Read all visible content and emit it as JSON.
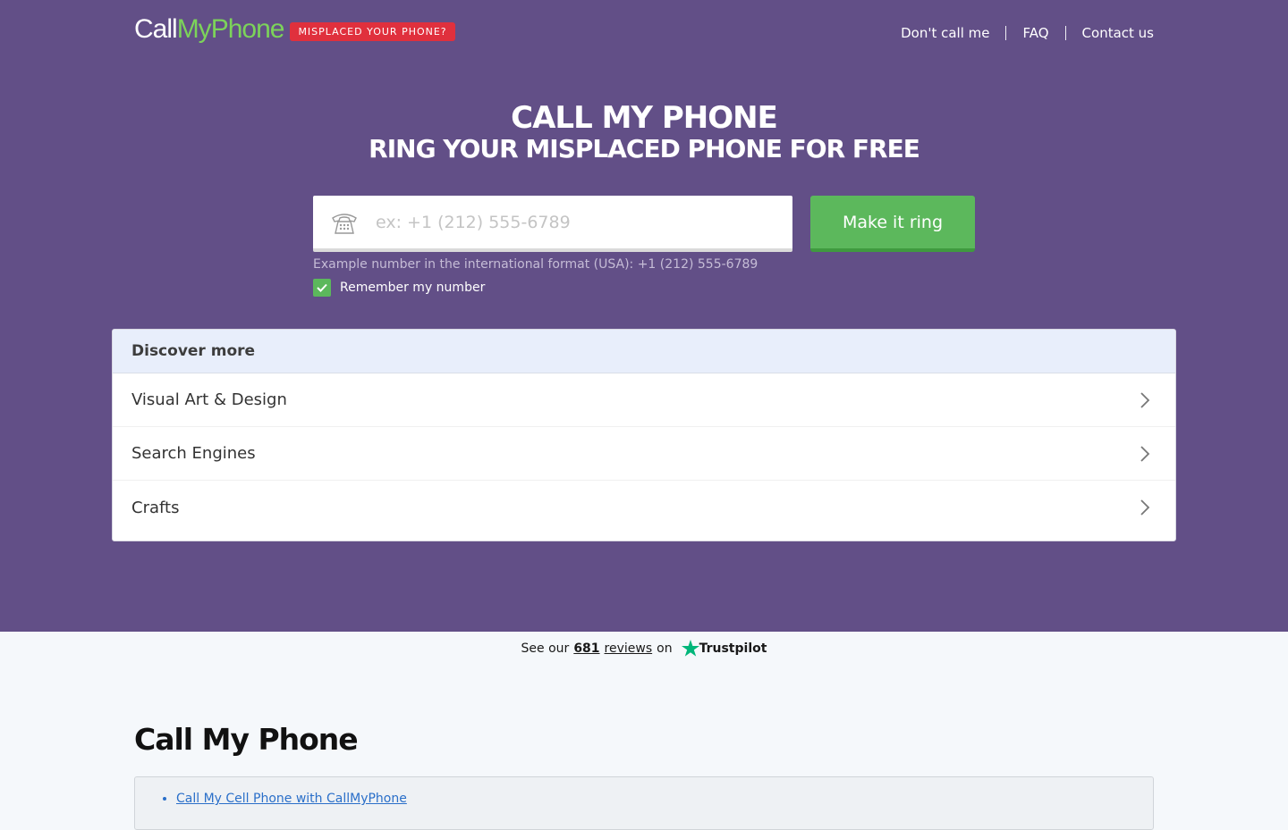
{
  "header": {
    "logo_call": "Call",
    "logo_my": "My",
    "logo_phone": "Phone",
    "badge": "MISPLACED YOUR PHONE?",
    "nav": [
      "Don't call me",
      "FAQ",
      "Contact us"
    ]
  },
  "hero": {
    "title": "CALL MY PHONE",
    "subtitle": "RING YOUR MISPLACED PHONE FOR FREE",
    "phone_placeholder": "ex: +1 (212) 555-6789",
    "button": "Make it ring",
    "hint": "Example number in the international format (USA): +1 (212) 555-6789",
    "remember_label": "Remember my number",
    "remember_checked": true
  },
  "discover": {
    "title": "Discover more",
    "items": [
      "Visual Art & Design",
      "Search Engines",
      "Crafts"
    ]
  },
  "trustpilot": {
    "prefix": "See our",
    "count": "681",
    "reviews_word": "reviews",
    "on": "on",
    "brand": "Trustpilot",
    "star_color": "#00b67a"
  },
  "content": {
    "heading": "Call My Phone",
    "toc": [
      "Call My Cell Phone with CallMyPhone"
    ]
  },
  "colors": {
    "hero_bg": "#624f87",
    "accent_green": "#5cb85c",
    "badge_red": "#e0303d"
  }
}
